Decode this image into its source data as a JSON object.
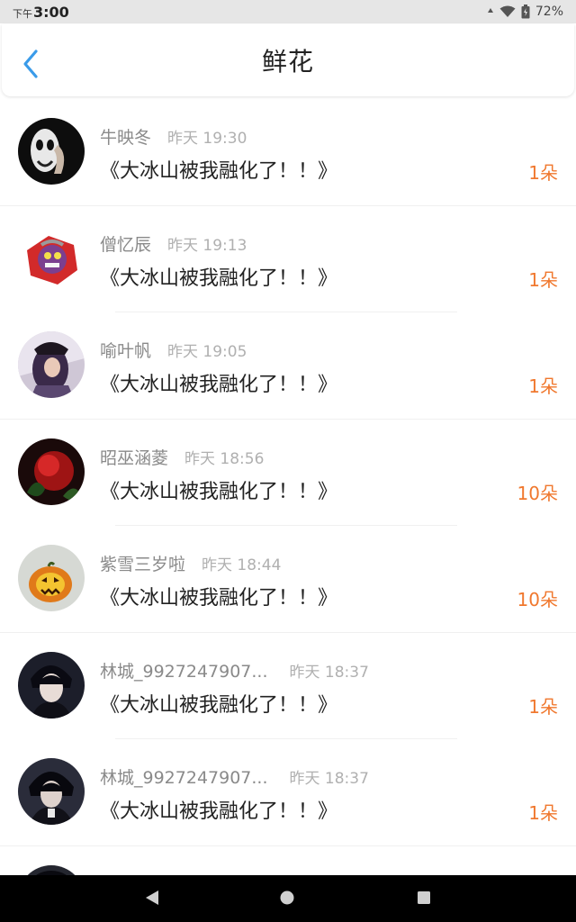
{
  "status_bar": {
    "ampm": "下午",
    "time": "3:00",
    "battery": "72%"
  },
  "header": {
    "title": "鲜花",
    "back_icon": "chevron-left-icon"
  },
  "colors": {
    "accent_blue": "#3a9be9",
    "count_orange": "#f0782e",
    "name_gray": "#8a8a8a",
    "time_gray": "#b0b0b0"
  },
  "items": [
    {
      "name": "牛映冬",
      "time": "昨天 19:30",
      "message": "《大冰山被我融化了！！》",
      "count": "1朵"
    },
    {
      "name": "僧忆辰",
      "time": "昨天 19:13",
      "message": "《大冰山被我融化了！！》",
      "count": "1朵"
    },
    {
      "name": "喻叶帆",
      "time": "昨天 19:05",
      "message": "《大冰山被我融化了！！》",
      "count": "1朵"
    },
    {
      "name": "昭巫涵菱",
      "time": "昨天 18:56",
      "message": "《大冰山被我融化了！！》",
      "count": "10朵"
    },
    {
      "name": "紫雪三岁啦",
      "time": "昨天 18:44",
      "message": "《大冰山被我融化了！！》",
      "count": "10朵"
    },
    {
      "name": "林城_9927247907...",
      "time": "昨天 18:37",
      "message": "《大冰山被我融化了！！》",
      "count": "1朵"
    },
    {
      "name": "林城_9927247907...",
      "time": "昨天 18:37",
      "message": "《大冰山被我融化了！！》",
      "count": "1朵"
    }
  ]
}
